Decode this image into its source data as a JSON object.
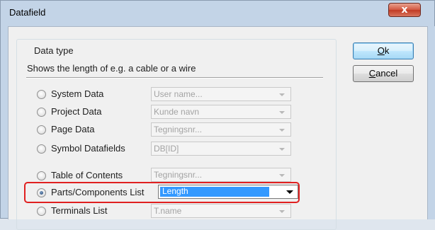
{
  "window": {
    "title": "Datafield",
    "close_glyph": "x"
  },
  "group": {
    "title": "Data type",
    "description": "Shows the length of e.g. a cable or a wire"
  },
  "options": [
    {
      "label": "System Data",
      "selected": false,
      "combo_value": "User name..."
    },
    {
      "label": "Project Data",
      "selected": false,
      "combo_value": "Kunde navn"
    },
    {
      "label": "Page Data",
      "selected": false,
      "combo_value": "Tegningsnr..."
    },
    {
      "label": "Symbol Datafields",
      "selected": false,
      "combo_value": "DB[ID]"
    },
    {
      "label": "Table of Contents",
      "selected": false,
      "combo_value": "Tegningsnr..."
    },
    {
      "label": "Parts/Components List",
      "selected": true,
      "combo_value": "Length"
    },
    {
      "label": "Terminals List",
      "selected": false,
      "combo_value": "T.name"
    }
  ],
  "buttons": {
    "ok": {
      "mnemonic": "O",
      "rest": "k"
    },
    "cancel": {
      "mnemonic": "C",
      "rest": "ancel"
    }
  },
  "colors": {
    "highlight": "#e02020",
    "selection": "#3399ff",
    "close": "#c13b24"
  },
  "icons": [
    "close-icon",
    "chevron-down-icon"
  ]
}
